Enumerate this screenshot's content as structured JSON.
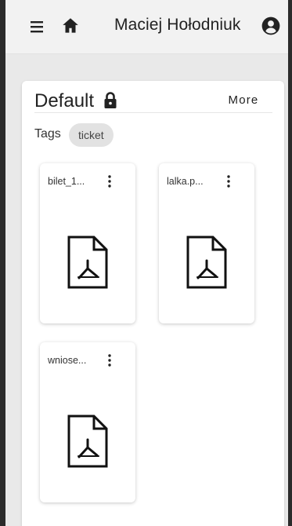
{
  "header": {
    "user_name": "Maciej Hołodniuk",
    "menu_icon": "hamburger-menu-icon",
    "home_icon": "home-icon",
    "account_icon": "account-circle-icon"
  },
  "folder": {
    "title": "Default",
    "lock_icon": "lock-icon",
    "more_label": "More",
    "tags_label": "Tags",
    "tags": [
      "ticket"
    ]
  },
  "files": [
    {
      "name": "bilet_1...",
      "type_icon": "pdf-file-icon"
    },
    {
      "name": "lalka.p...",
      "type_icon": "pdf-file-icon"
    },
    {
      "name": "wniose...",
      "type_icon": "pdf-file-icon"
    }
  ],
  "colors": {
    "topbar": "#f2f2f2",
    "page_background": "#e9e9e9",
    "card": "#ffffff",
    "chip": "#e2e2e2"
  }
}
